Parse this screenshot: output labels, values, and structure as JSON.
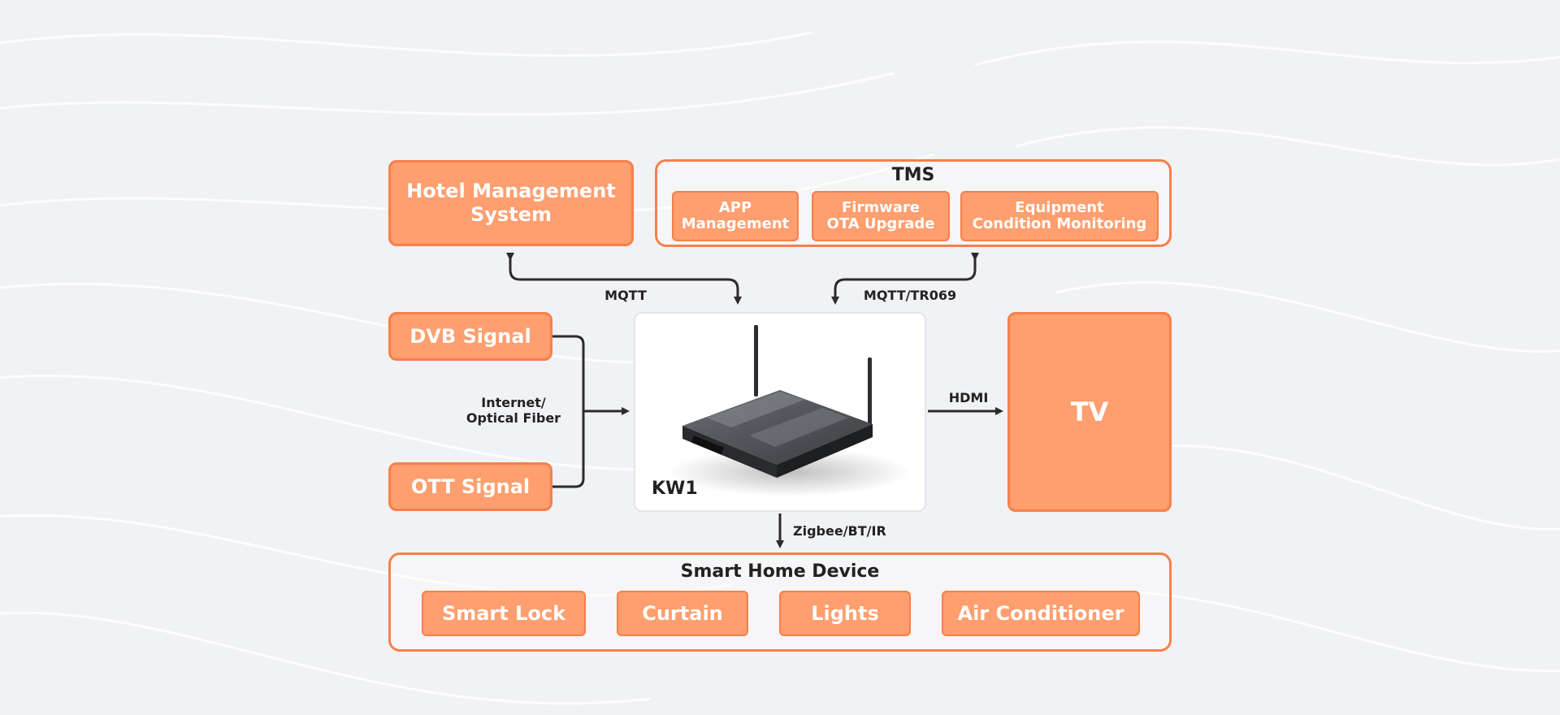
{
  "colors": {
    "box_fill": "#ff9e6e",
    "box_border": "#f5804b",
    "connector": "#2b2b2b",
    "text_dark": "#222222",
    "background": "#f1f2f5"
  },
  "nodes": {
    "hotel_management": {
      "label": "Hotel Management\nSystem"
    },
    "tms": {
      "title": "TMS",
      "items": [
        {
          "label": "APP\nManagement"
        },
        {
          "label": "Firmware\nOTA Upgrade"
        },
        {
          "label": "Equipment\nCondition Monitoring"
        }
      ]
    },
    "dvb_signal": {
      "label": "DVB Signal"
    },
    "ott_signal": {
      "label": "OTT Signal"
    },
    "hub": {
      "label": "KW1",
      "icon": "router-icon"
    },
    "tv": {
      "label": "TV"
    },
    "smart_home": {
      "title": "Smart Home Device",
      "items": [
        {
          "label": "Smart Lock"
        },
        {
          "label": "Curtain"
        },
        {
          "label": "Lights"
        },
        {
          "label": "Air Conditioner"
        }
      ]
    }
  },
  "connections": {
    "hms_hub": {
      "label": "MQTT"
    },
    "tms_hub": {
      "label": "MQTT/TR069"
    },
    "signals_hub": {
      "label": "Internet/\nOptical Fiber"
    },
    "hub_tv": {
      "label": "HDMI"
    },
    "hub_smart_home": {
      "label": "Zigbee/BT/IR"
    }
  }
}
